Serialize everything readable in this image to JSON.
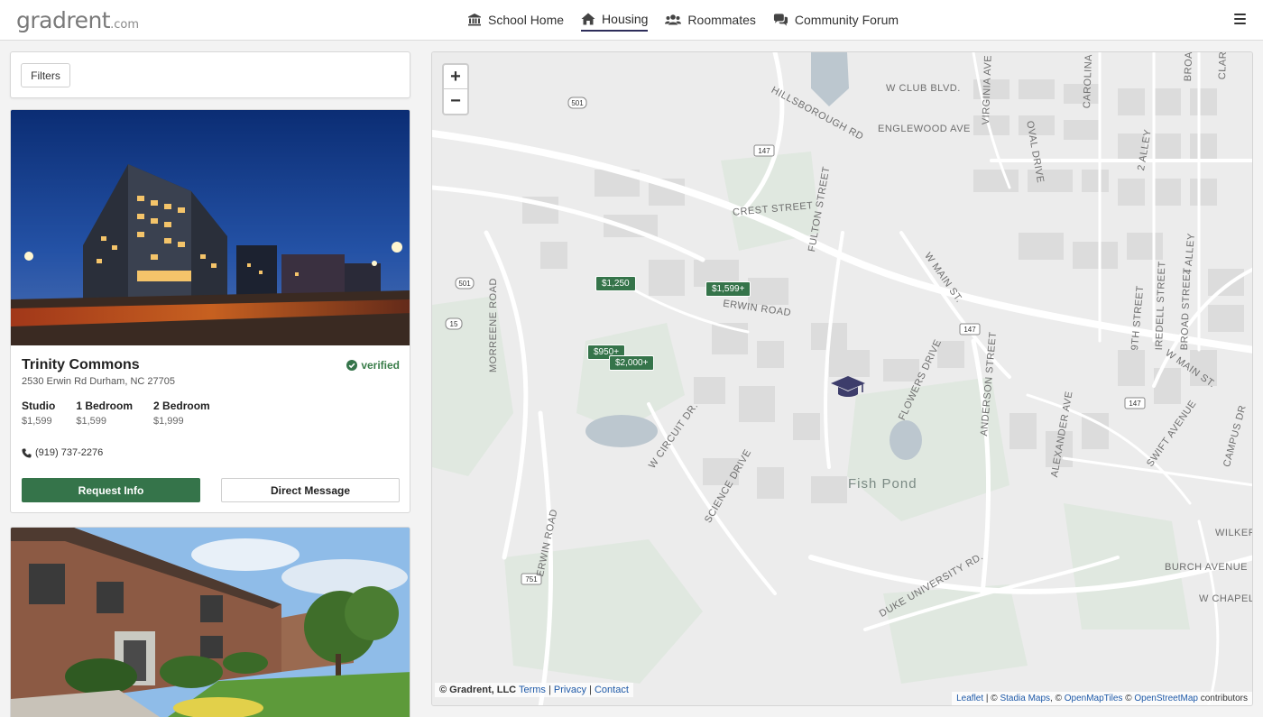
{
  "brand": {
    "logo_main": "gradrent",
    "logo_domain": ".com"
  },
  "nav": {
    "items": [
      {
        "label": "School Home",
        "icon": "university-icon"
      },
      {
        "label": "Housing",
        "icon": "home-icon",
        "active": true
      },
      {
        "label": "Roommates",
        "icon": "users-icon"
      },
      {
        "label": "Community Forum",
        "icon": "comments-icon"
      }
    ],
    "menu_icon": "hamburger-icon"
  },
  "filters": {
    "label": "Filters"
  },
  "listings": [
    {
      "name": "Trinity Commons",
      "address": "2530 Erwin Rd Durham, NC 27705",
      "verified_label": "verified",
      "units": [
        {
          "type": "Studio",
          "price": "$1,599"
        },
        {
          "type": "1 Bedroom",
          "price": "$1,599"
        },
        {
          "type": "2 Bedroom",
          "price": "$1,999"
        }
      ],
      "phone": "(919) 737-2276",
      "request_label": "Request Info",
      "message_label": "Direct Message"
    }
  ],
  "map": {
    "zoom_in": "+",
    "zoom_out": "−",
    "price_markers": [
      "$1,250",
      "$1,599+",
      "$950+",
      "$2,000+"
    ],
    "street_labels": [
      "W CLUB BLVD.",
      "HILLSBOROUGH RD",
      "ENGLEWOOD AVE",
      "CREST STREET",
      "FULTON STREET",
      "W MAIN ST.",
      "ERWIN ROAD",
      "MORREENE ROAD",
      "W CIRCUIT DR.",
      "SCIENCE DRIVE",
      "ERWIN ROAD",
      "FLOWERS DRIVE",
      "ANDERSON STREET",
      "ALEXANDER AVE",
      "SWIFT AVENUE",
      "W MAIN ST.",
      "9TH STREET",
      "IREDELL STREET",
      "BROAD STREET",
      "DUKE UNIVERSITY RD.",
      "WILKERS",
      "BURCH AVENUE",
      "W CHAPEL",
      "VIRGINIA AVE",
      "OVAL DRIVE",
      "CAROLINA",
      "2 ALLEY",
      "4 ALLEY",
      "CAMPUS DR",
      "BROA",
      "CLARE"
    ],
    "pond_label": "Fish Pond",
    "route_shields": [
      "501",
      "147",
      "501",
      "15",
      "147",
      "147",
      "751"
    ],
    "copyright": {
      "owner": "© Gradrent, LLC",
      "links": [
        "Terms",
        "Privacy",
        "Contact"
      ]
    },
    "attribution": {
      "leaflet": "Leaflet",
      "providers": [
        "Stadia Maps",
        "OpenMapTiles",
        "OpenStreetMap"
      ],
      "suffix": "contributors"
    }
  },
  "colors": {
    "accent_green": "#35744a",
    "nav_active_underline": "#2d2d5a",
    "campus_marker": "#3d3d6b",
    "link_blue": "#1f5aa8"
  }
}
